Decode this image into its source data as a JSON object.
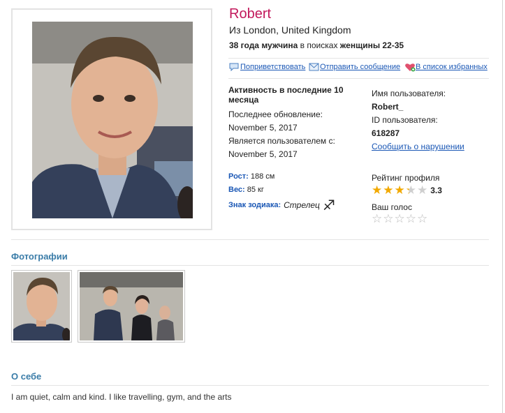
{
  "profile": {
    "name": "Robert",
    "location": "Из London, United Kingdom",
    "summary": {
      "age_gender": "38 года мужчина",
      "seeking_word": " в поисках ",
      "seeking_target": "женщины 22-35"
    }
  },
  "actions": {
    "greet": "Поприветствовать",
    "message": "Отправить сообщение",
    "favorites": "В список избранных"
  },
  "activity": {
    "heading": "Активность в последние 10 месяца",
    "last_update_label": "Последнее обновление:",
    "last_update_value": "November 5, 2017",
    "member_since_label": "Является пользователем с:",
    "member_since_value": "November 5, 2017"
  },
  "stats": {
    "height_label": "Рост:",
    "height_value": "188 см",
    "weight_label": "Вес:",
    "weight_value": "85 кг",
    "zodiac_label": "Знак зодиака:",
    "zodiac_value": "Стрелец",
    "zodiac_symbol": "♐"
  },
  "user": {
    "username_label": "Имя пользователя:",
    "username": "Robert_",
    "id_label": "ID пользователя:",
    "id": "618287",
    "report_link": "Сообщить о нарушении"
  },
  "rating": {
    "label": "Рейтинг профиля",
    "value": "3.3",
    "score": 3.3,
    "max": 5,
    "vote_label": "Ваш голос",
    "vote_score": 0
  },
  "photos": {
    "title": "Фотографии",
    "count": 2
  },
  "about": {
    "title": "О себе",
    "text": "I am quiet, calm and kind. I like travelling, gym, and the arts"
  },
  "colors": {
    "name": "#c2185b",
    "link": "#1a57b5",
    "section_title": "#3a7ca8",
    "star_filled": "#f2a900",
    "star_empty": "#cfcfcf"
  }
}
